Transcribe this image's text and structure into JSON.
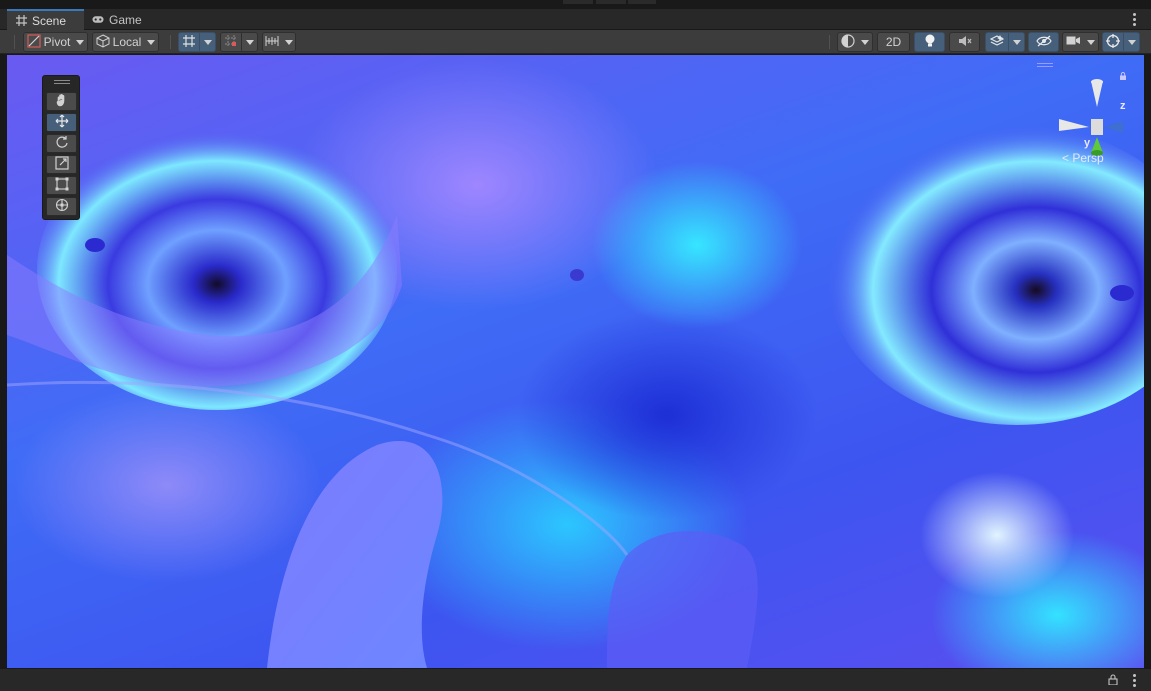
{
  "tabs": [
    {
      "label": "Scene",
      "icon": "grid-icon",
      "active": true
    },
    {
      "label": "Game",
      "icon": "gamepad-icon",
      "active": false
    }
  ],
  "toolbar": {
    "pivot_label": "Pivot",
    "local_label": "Local",
    "mode_2d_label": "2D"
  },
  "gizmo": {
    "y_label": "y",
    "z_label": "z",
    "projection_label": "Persp"
  },
  "colors": {
    "accent_active": "#46607c",
    "tab_highlight": "#3a79bb"
  }
}
